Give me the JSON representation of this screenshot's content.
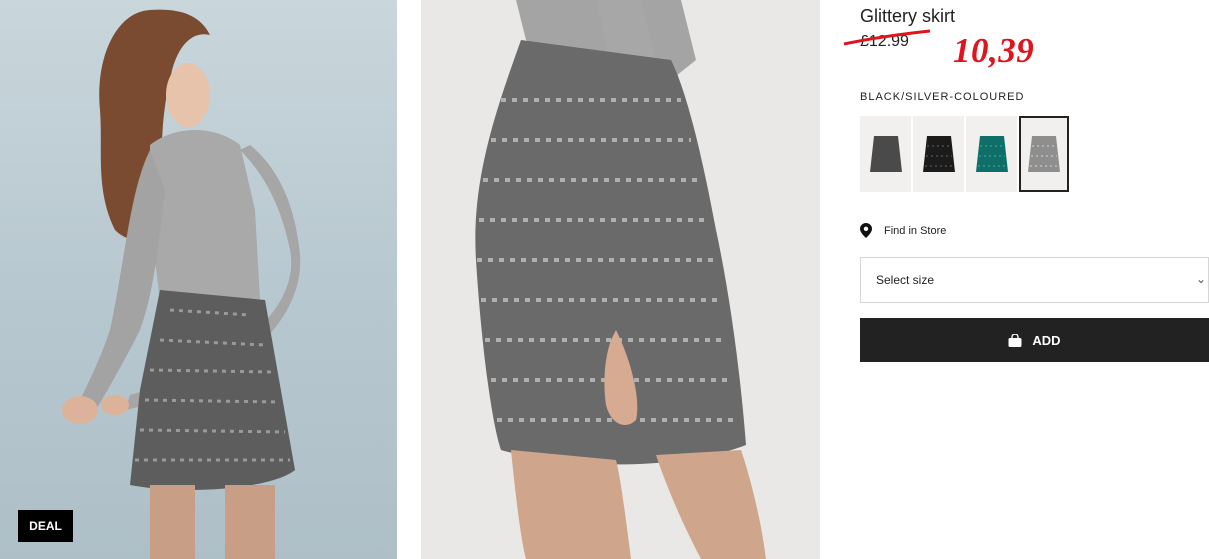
{
  "product": {
    "title": "Glittery skirt",
    "old_price": "£12.99",
    "new_price": "10,39",
    "color_label": "BLACK/SILVER-COLOURED",
    "swatches": [
      {
        "name": "dark-grey-glitter",
        "color": "#4a4a4a"
      },
      {
        "name": "black-sequin",
        "color": "#1b1b1b"
      },
      {
        "name": "green-sequin",
        "color": "#0f6e67"
      },
      {
        "name": "black-silver-sequin",
        "color": "#8e8e8e"
      }
    ]
  },
  "badge": {
    "label": "DEAL"
  },
  "store": {
    "label": "Find in Store",
    "icon": "map-pin-icon"
  },
  "size_select": {
    "placeholder": "Select size",
    "icon": "chevron-down-icon"
  },
  "add_button": {
    "label": "ADD",
    "icon": "shopping-bag-icon"
  },
  "colors": {
    "accent_red": "#e0141c",
    "button_bg": "#222222"
  }
}
